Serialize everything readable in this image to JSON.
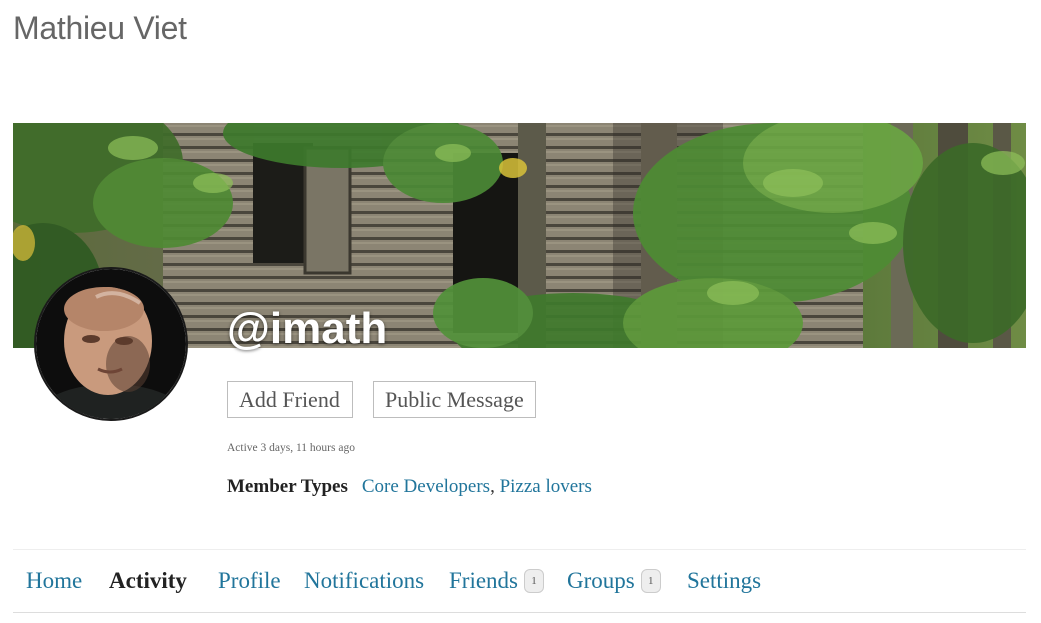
{
  "site": {
    "title": "Mathieu Viet"
  },
  "profile": {
    "handle": "@imath",
    "last_active": "Active 3 days, 11 hours ago",
    "member_types_label": "Member Types",
    "member_types": [
      "Core Developers",
      "Pizza lovers"
    ],
    "member_types_separator": ","
  },
  "actions": {
    "add_friend": "Add Friend",
    "public_message": "Public Message"
  },
  "nav": {
    "items": [
      {
        "label": "Home"
      },
      {
        "label": "Activity",
        "current": true
      },
      {
        "label": "Profile"
      },
      {
        "label": "Notifications"
      },
      {
        "label": "Friends",
        "count": "1"
      },
      {
        "label": "Groups",
        "count": "1"
      },
      {
        "label": "Settings"
      }
    ]
  },
  "colors": {
    "link": "#21759b",
    "title_gray": "#666666",
    "text_dark": "#222222"
  }
}
